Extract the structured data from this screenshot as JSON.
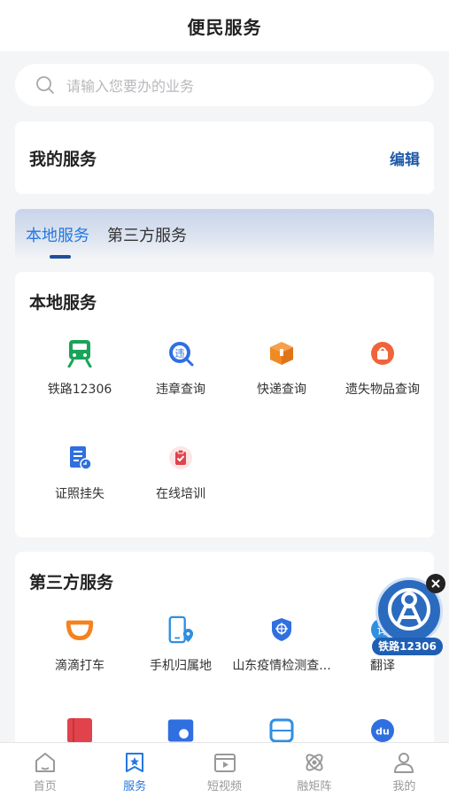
{
  "header": {
    "title": "便民服务"
  },
  "search": {
    "placeholder": "请输入您要办的业务"
  },
  "my_services": {
    "title": "我的服务",
    "edit_label": "编辑"
  },
  "tabs": [
    {
      "label": "本地服务",
      "active": true
    },
    {
      "label": "第三方服务",
      "active": false
    }
  ],
  "local_services": {
    "title": "本地服务",
    "items": [
      {
        "label": "铁路12306",
        "icon": "train-icon",
        "color": "#1aa35a"
      },
      {
        "label": "违章查询",
        "icon": "violation-query-icon",
        "color": "#2f6fe0"
      },
      {
        "label": "快递查询",
        "icon": "package-icon",
        "color": "#f08a24"
      },
      {
        "label": "遗失物品查询",
        "icon": "lost-items-icon",
        "color": "#f0643c"
      },
      {
        "label": "证照挂失",
        "icon": "license-loss-icon",
        "color": "#2f6fe0"
      },
      {
        "label": "在线培训",
        "icon": "online-training-icon",
        "color": "#e0434c"
      }
    ]
  },
  "third_party_services": {
    "title": "第三方服务",
    "items": [
      {
        "label": "滴滴打车",
        "icon": "didi-icon",
        "color": "#f5821f"
      },
      {
        "label": "手机归属地",
        "icon": "phone-location-icon",
        "color": "#2f8fe0"
      },
      {
        "label": "山东疫情检测查...",
        "icon": "shield-icon",
        "color": "#2f6fe0"
      },
      {
        "label": "翻译",
        "icon": "translate-icon",
        "color": "#2f8fe0"
      }
    ],
    "second_row_icons": [
      {
        "icon": "book-icon",
        "color": "#e0434c"
      },
      {
        "icon": "photo-icon",
        "color": "#2f6fe0"
      },
      {
        "icon": "bus-icon",
        "color": "#2f8fe0"
      },
      {
        "icon": "baidu-icon",
        "color": "#2f6fe0"
      }
    ]
  },
  "floating_badge": {
    "label": "铁路12306",
    "icon": "railway-logo-icon"
  },
  "bottom_nav": [
    {
      "label": "首页",
      "icon": "home-icon",
      "active": false
    },
    {
      "label": "服务",
      "icon": "service-icon",
      "active": true
    },
    {
      "label": "短视频",
      "icon": "short-video-icon",
      "active": false
    },
    {
      "label": "融矩阵",
      "icon": "matrix-icon",
      "active": false
    },
    {
      "label": "我的",
      "icon": "profile-icon",
      "active": false
    }
  ],
  "colors": {
    "accent": "#2478e0",
    "edit": "#1e5aa8",
    "tab_indicator": "#1e4f9c"
  }
}
